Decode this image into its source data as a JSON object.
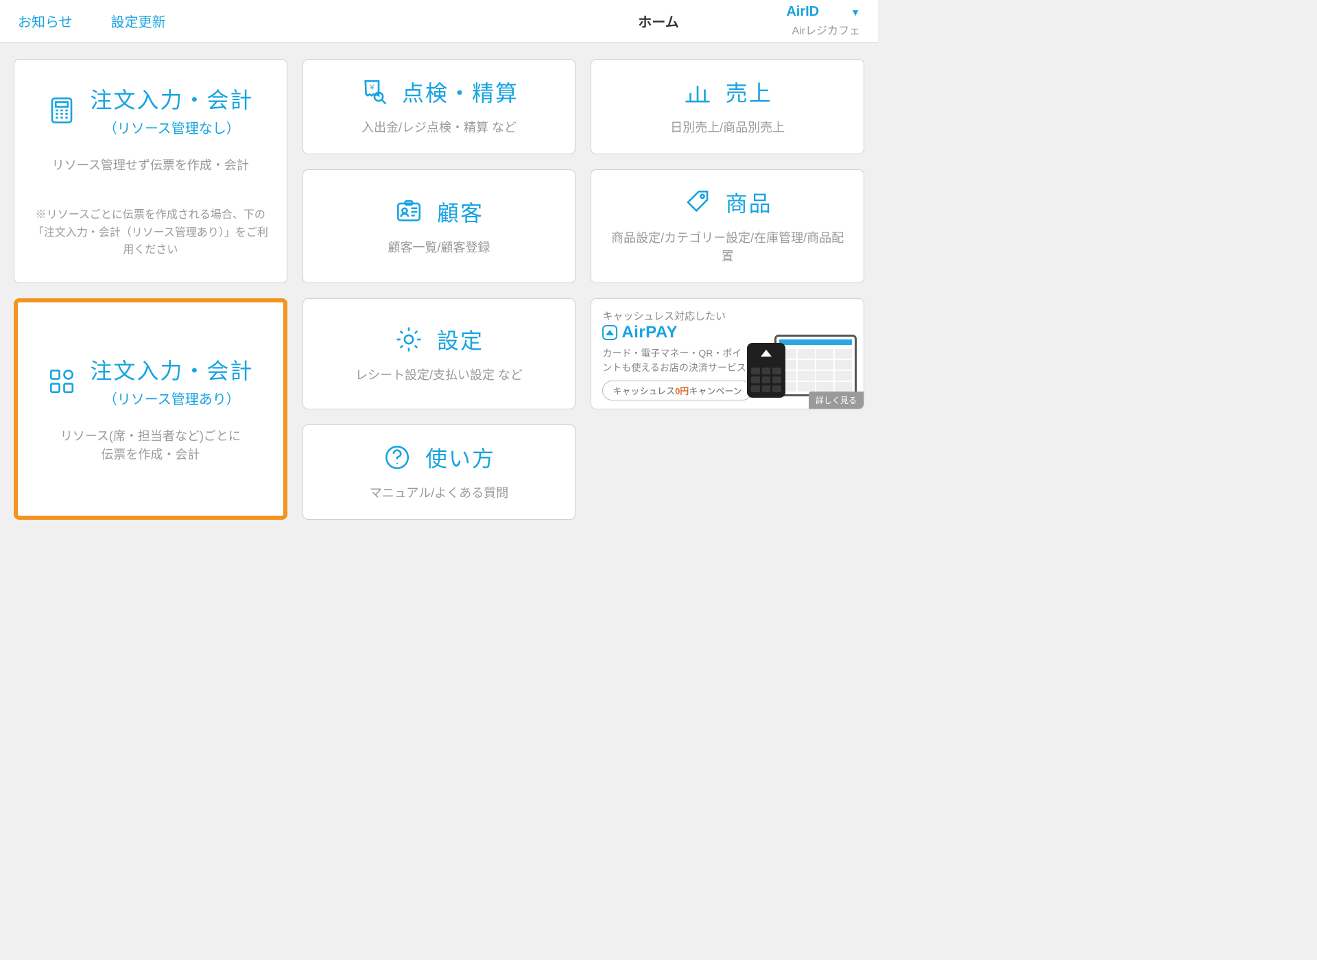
{
  "header": {
    "notice": "お知らせ",
    "refresh": "設定更新",
    "title": "ホーム",
    "account": "AirID",
    "store": "Airレジカフェ"
  },
  "cards": {
    "order_no_resource": {
      "title": "注文入力・会計",
      "subtitle": "（リソース管理なし）",
      "desc": "リソース管理せず伝票を作成・会計",
      "note": "※リソースごとに伝票を作成される場合、下の「注文入力・会計（リソース管理あり）」をご利用ください"
    },
    "order_with_resource": {
      "title": "注文入力・会計",
      "subtitle": "（リソース管理あり）",
      "desc": "リソース(席・担当者など)ごとに\n伝票を作成・会計"
    },
    "inspection": {
      "title": "点検・精算",
      "desc": "入出金/レジ点検・精算 など"
    },
    "sales": {
      "title": "売上",
      "desc": "日別売上/商品別売上"
    },
    "customer": {
      "title": "顧客",
      "desc": "顧客一覧/顧客登録"
    },
    "product": {
      "title": "商品",
      "desc": "商品設定/カテゴリー設定/在庫管理/商品配置"
    },
    "settings": {
      "title": "設定",
      "desc": "レシート設定/支払い設定 など"
    },
    "help": {
      "title": "使い方",
      "desc": "マニュアル/よくある質問"
    }
  },
  "promo": {
    "lead": "キャッシュレス対応したい",
    "brand": "AirPAY",
    "desc": "カード・電子マネー・QR・ポイントも使えるお店の決済サービス",
    "badge_pre": "キャッシュレス",
    "badge_em": "0円",
    "badge_post": "キャンペーン",
    "more": "詳しく見る"
  }
}
